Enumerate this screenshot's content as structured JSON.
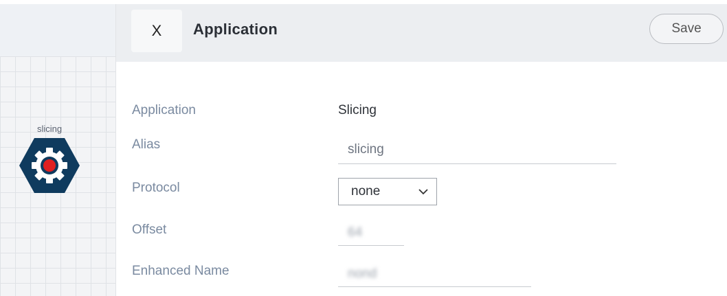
{
  "canvas": {
    "node": {
      "label": "slicing",
      "icon": "gear-hexagon-icon"
    }
  },
  "header": {
    "close_label": "X",
    "title": "Application",
    "save_label": "Save"
  },
  "form": {
    "application": {
      "label": "Application",
      "value": "Slicing"
    },
    "alias": {
      "label": "Alias",
      "value": "slicing"
    },
    "protocol": {
      "label": "Protocol",
      "value": "none"
    },
    "offset": {
      "label": "Offset",
      "value": "64"
    },
    "enhanced_name": {
      "label": "Enhanced Name",
      "value": "nond"
    }
  },
  "colors": {
    "node_fill": "#0f3b5e",
    "node_center": "#e02020",
    "label": "#7a8aa0"
  }
}
